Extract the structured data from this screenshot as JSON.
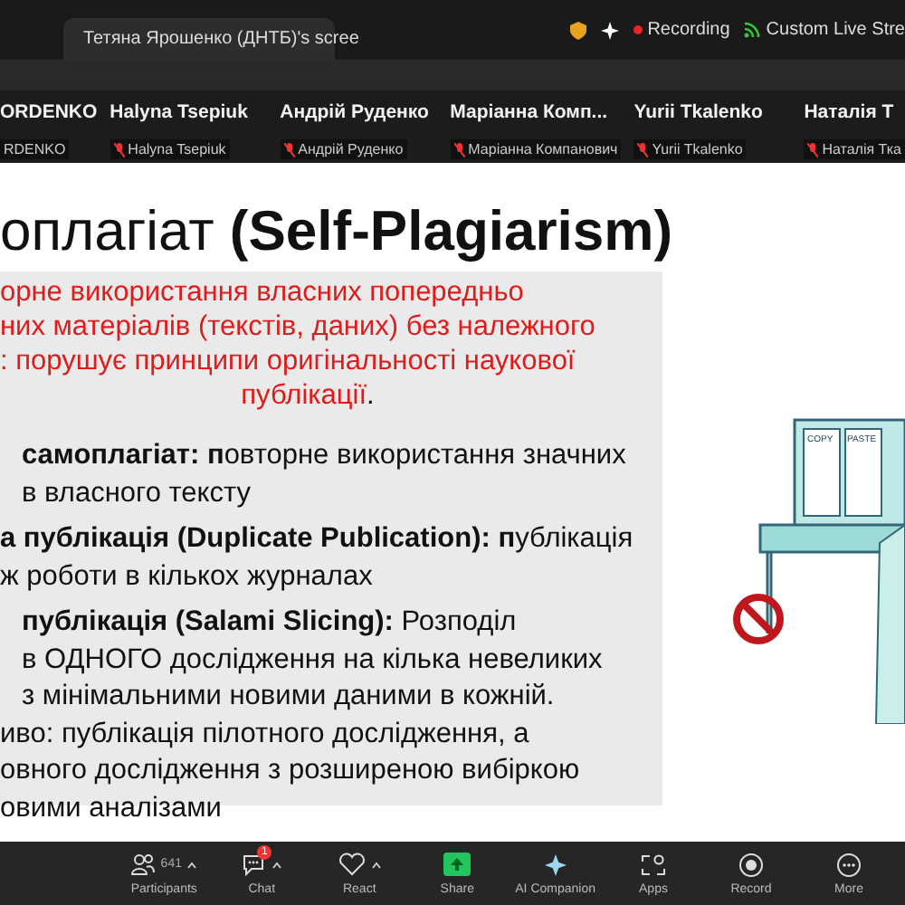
{
  "top_bar": {
    "tab_title": "Тетяна Ярошенко (ДНТБ)'s scree",
    "recording": "Recording",
    "live_stream": "Custom Live Stre"
  },
  "participants": [
    {
      "name": "ORDENKO",
      "nameplate": "RDENKO",
      "muted": false
    },
    {
      "name": "Halyna Tsepiuk",
      "nameplate": "Halyna Tsepiuk",
      "muted": true
    },
    {
      "name": "Андрій Руденко",
      "nameplate": "Андрій Руденко",
      "muted": true
    },
    {
      "name": "Маріанна Комп...",
      "nameplate": "Маріанна Компанович",
      "muted": true
    },
    {
      "name": "Yurii Tkalenko",
      "nameplate": "Yurii Tkalenko",
      "muted": true
    },
    {
      "name": "Наталія Т",
      "nameplate": "Наталія Тка",
      "muted": true
    }
  ],
  "slide": {
    "title": "оплагіат **(Self-Plagiarism)**",
    "definition_lines": [
      "орне використання власних попередньо",
      "них матеріалів (текстів, даних) без належного",
      ": порушує принципи оригінальності наукової",
      "публікації"
    ],
    "definition_end": ".",
    "body_lines": [
      "**самоплагіат:** **п**овторне використання значних",
      "в власного тексту",
      "**а публікація (Duplicate Publication):** **п**ублікація",
      "ж роботи в кількох журналах",
      "**публікація (Salami Slicing):** Розподіл",
      "в ОДНОГО дослідження на кілька невеликих",
      "з  мінімальними новими даними в кожній.",
      "иво: публікація пілотного дослідження, а",
      "овного дослідження з розширеною вибіркою",
      "овими аналізами"
    ],
    "illustration": {
      "screen_1": "COPY",
      "screen_2": "PASTE"
    }
  },
  "toolbar": [
    {
      "kind": "participants",
      "label": "Participants",
      "count": "641",
      "caret": true
    },
    {
      "kind": "chat",
      "label": "Chat",
      "badge": "1",
      "caret": true
    },
    {
      "kind": "react",
      "label": "React",
      "caret": true
    },
    {
      "kind": "share",
      "label": "Share",
      "caret": false
    },
    {
      "kind": "ai",
      "label": "AI Companion",
      "caret": false
    },
    {
      "kind": "apps",
      "label": "Apps",
      "caret": false
    },
    {
      "kind": "record",
      "label": "Record",
      "caret": false
    },
    {
      "kind": "more",
      "label": "More",
      "caret": false
    }
  ]
}
